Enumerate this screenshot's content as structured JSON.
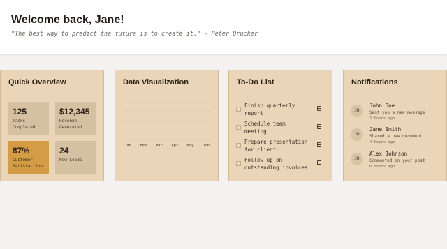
{
  "header": {
    "welcome": "Welcome back, Jane!",
    "quote": "\"The best way to predict the future is to create it.\" - Peter Drucker"
  },
  "overview": {
    "title": "Quick Overview",
    "stats": [
      {
        "value": "125",
        "label_line1": "Tasks",
        "label_line2": "Completed"
      },
      {
        "value": "$12,345",
        "label_line1": "Revenue",
        "label_line2": "Generated"
      },
      {
        "value": "87%",
        "label_line1": "Customer",
        "label_line2": "Satisfaction"
      },
      {
        "value": "24",
        "label_line1": "New Leads",
        "label_line2": ""
      }
    ]
  },
  "dataviz": {
    "title": "Data Visualization"
  },
  "chart_data": {
    "type": "line",
    "categories": [
      "Jan",
      "Feb",
      "Mar",
      "Apr",
      "May",
      "Jun"
    ],
    "series": [],
    "title": "",
    "xlabel": "",
    "ylabel": "",
    "grid": true
  },
  "todo": {
    "title": "To-Do List",
    "items": [
      {
        "line1": "Finish quarterly",
        "line2": "report"
      },
      {
        "line1": "Schedule team",
        "line2": "meeting"
      },
      {
        "line1": "Prepare presentation",
        "line2": "for client"
      },
      {
        "line1": "Follow up on",
        "line2": "outstanding invoices"
      }
    ]
  },
  "notifications": {
    "title": "Notifications",
    "items": [
      {
        "initials": "JD",
        "name": "John Doe",
        "message": "Sent you a new message",
        "time": "2 hours ago"
      },
      {
        "initials": "JD",
        "name": "Jane Smith",
        "message": "Shared a new document",
        "time": "4 hours ago"
      },
      {
        "initials": "JD",
        "name": "Alex Johnson",
        "message": "Commented on your post",
        "time": "6 hours ago"
      }
    ]
  },
  "colors": {
    "card_bg": "#ead5b9",
    "card_border": "#d7b995",
    "stat_bg": "#d6c0a2",
    "accent": "#d39c45",
    "page_bg": "#f3f2f0"
  }
}
